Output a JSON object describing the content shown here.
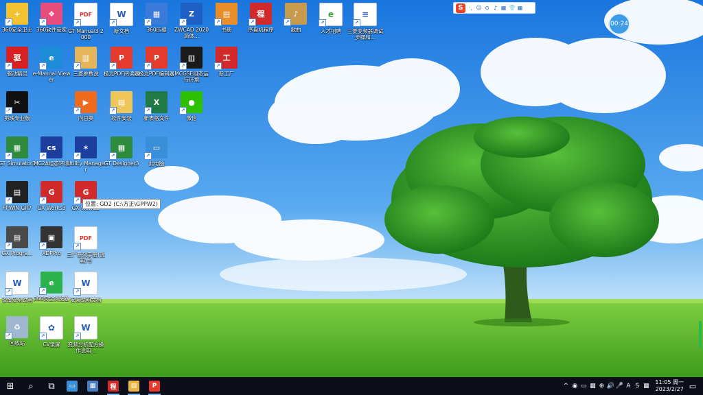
{
  "desktop": {
    "icons": [
      {
        "label": "360安全卫士",
        "icon": "360-safe-icon",
        "color": "#f2c230",
        "glyph": "+"
      },
      {
        "label": "360软件管家",
        "icon": "360-software-icon",
        "color": "#e84c7d",
        "glyph": "❖"
      },
      {
        "label": "GT Manual3 2000",
        "icon": "pdf-icon",
        "color": "#ffffff",
        "glyph": "PDF"
      },
      {
        "label": "新文档",
        "icon": "word-doc-icon",
        "color": "#ffffff",
        "glyph": "W"
      },
      {
        "label": "360压缩",
        "icon": "360-zip-icon",
        "color": "#3a7ad9",
        "glyph": "▦"
      },
      {
        "label": "ZWCAD 2020 简体...",
        "icon": "zwcad-icon",
        "color": "#1d5fc2",
        "glyph": "Z"
      },
      {
        "label": "书册",
        "icon": "folder-book-icon",
        "color": "#e98c2a",
        "glyph": "▤"
      },
      {
        "label": "序盘机程序",
        "icon": "plc-program-icon",
        "color": "#d22a2a",
        "glyph": "程"
      },
      {
        "label": "歌曲",
        "icon": "music-folder-icon",
        "color": "#c89a4c",
        "glyph": "♪"
      },
      {
        "label": "人才招聘",
        "icon": "ie-browser-icon",
        "color": "#ffffff",
        "glyph": "e"
      },
      {
        "label": "三菱变频器调试步骤和...",
        "icon": "text-doc-icon",
        "color": "#ffffff",
        "glyph": "≡"
      },
      {
        "label": "驱动精灵",
        "icon": "driver-genius-icon",
        "color": "#d92020",
        "glyph": "驱"
      },
      {
        "label": "e-Manual Viewer",
        "icon": "emanual-icon",
        "color": "#1c8bd8",
        "glyph": "e"
      },
      {
        "label": "三菱参数说",
        "icon": "folder-docs-icon",
        "color": "#e5b659",
        "glyph": "▥"
      },
      {
        "label": "极光PDF阅读器",
        "icon": "pdf-reader-icon",
        "color": "#e53b2e",
        "glyph": "P"
      },
      {
        "label": "极光PDF编辑器",
        "icon": "pdf-editor-icon",
        "color": "#e53b2e",
        "glyph": "P"
      },
      {
        "label": "MCGSE组态运行环境",
        "icon": "mcgs-run-icon",
        "color": "#1a1a1a",
        "glyph": "▥"
      },
      {
        "label": "新工厂",
        "icon": "factory-icon",
        "color": "#d22a2a",
        "glyph": "工"
      },
      {
        "label": "剪映专业版",
        "icon": "capcut-icon",
        "color": "#111111",
        "glyph": "✂"
      },
      {
        "label": "向日葵",
        "icon": "sunlogin-icon",
        "color": "#f06a1d",
        "glyph": "▶"
      },
      {
        "label": "软件安装",
        "icon": "folder-icon",
        "color": "#f0c55a",
        "glyph": "▤"
      },
      {
        "label": "新表格文件",
        "icon": "excel-icon",
        "color": "#1f7a44",
        "glyph": "X"
      },
      {
        "label": "微信",
        "icon": "wechat-icon",
        "color": "#2dc100",
        "glyph": "●"
      },
      {
        "label": "GT Simulator3",
        "icon": "gt-simulator-icon",
        "color": "#2e8b3e",
        "glyph": "▦"
      },
      {
        "label": "MC2A组态环境",
        "icon": "mcgs-config-icon",
        "color": "#1c3e9c",
        "glyph": "cs"
      },
      {
        "label": "Utility Manager",
        "icon": "utility-manager-icon",
        "color": "#1c3e9c",
        "glyph": "✶"
      },
      {
        "label": "GT Designer3",
        "icon": "gt-designer-icon",
        "color": "#2e8b3e",
        "glyph": "▦"
      },
      {
        "label": "此电脑",
        "icon": "computer-icon",
        "color": "#3a8fd9",
        "glyph": "▭"
      },
      {
        "label": "FPWIN GR7",
        "icon": "fpwin-icon",
        "color": "#222222",
        "glyph": "▤"
      },
      {
        "label": "GX Works3",
        "icon": "gx-works3-icon",
        "color": "#d22a2a",
        "glyph": "G"
      },
      {
        "label": "GX Works2",
        "icon": "gx-works2-icon",
        "color": "#d22a2a",
        "glyph": "G"
      },
      {
        "label": "GX Progra...",
        "icon": "gx-developer-icon",
        "color": "#4a4a4a",
        "glyph": "▤"
      },
      {
        "label": "XDPPro",
        "icon": "xdppro-icon",
        "color": "#333333",
        "glyph": "▣"
      },
      {
        "label": "三广系列手册(说明)书",
        "icon": "pdf-manual-icon",
        "color": "#ffffff",
        "glyph": "PDF"
      },
      {
        "label": "设备安全说明",
        "icon": "word-doc-icon",
        "color": "#ffffff",
        "glyph": "W"
      },
      {
        "label": "360安全浏览器",
        "icon": "360-browser-icon",
        "color": "#2bb24c",
        "glyph": "e"
      },
      {
        "label": "安装说明文档",
        "icon": "word-doc-icon",
        "color": "#ffffff",
        "glyph": "W"
      },
      {
        "label": "回收站",
        "icon": "recycle-bin-icon",
        "color": "#9fb8cf",
        "glyph": "♻"
      },
      {
        "label": "CV录屏",
        "icon": "cv-record-icon",
        "color": "#ffffff",
        "glyph": "✿"
      },
      {
        "label": "变频分析配方操作说明...",
        "icon": "word-doc-icon",
        "color": "#ffffff",
        "glyph": "W"
      }
    ],
    "tooltip": "位置: GD2 (C:\\方正\\GPPW2)"
  },
  "ime_toolbar": {
    "logo": "S",
    "tools": [
      "·,",
      "☺",
      "⊙",
      "♪",
      "▦",
      "👕",
      "▦"
    ]
  },
  "timer": "00:24",
  "taskbar": {
    "start_glyph": "⊞",
    "search_glyph": "⌕",
    "taskview_glyph": "⧉",
    "apps": [
      {
        "name": "explorer-window-app",
        "color": "#3a8fd9",
        "glyph": "▭"
      },
      {
        "name": "calculator-app",
        "color": "#4a7fbf",
        "glyph": "▦"
      },
      {
        "name": "plc-program-app",
        "color": "#d22a2a",
        "glyph": "程"
      },
      {
        "name": "file-explorer-app",
        "color": "#e8b640",
        "glyph": "▤"
      },
      {
        "name": "pdf-app",
        "color": "#e53b2e",
        "glyph": "P"
      }
    ],
    "tray": {
      "icons": [
        "^",
        "◉",
        "▭",
        "▦",
        "⊕",
        "🔊",
        "🎤",
        "A",
        "S",
        "▦"
      ],
      "time": "11:05 周一",
      "date": "2023/2/27"
    },
    "notification_glyph": "▭"
  },
  "colors": {
    "sky_top": "#1d7fe0",
    "sky_bottom": "#b8dcf7",
    "grass": "#5bb52a",
    "taskbar": "#0c0f19"
  }
}
